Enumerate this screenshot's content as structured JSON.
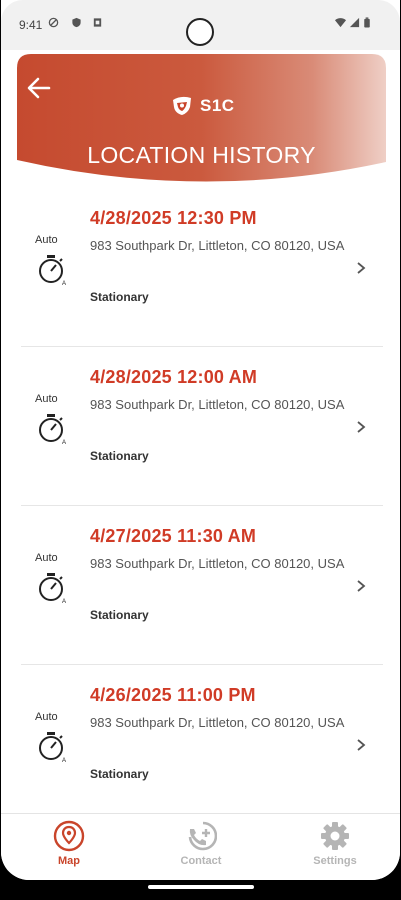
{
  "status_bar": {
    "time": "9:41"
  },
  "header": {
    "logo_text": "S1C",
    "title": "LOCATION HISTORY"
  },
  "items": [
    {
      "mode": "Auto",
      "datetime": "4/28/2025 12:30 PM",
      "address": "983 Southpark Dr, Littleton, CO 80120, USA",
      "status": "Stationary"
    },
    {
      "mode": "Auto",
      "datetime": "4/28/2025 12:00 AM",
      "address": "983 Southpark Dr, Littleton, CO 80120, USA",
      "status": "Stationary"
    },
    {
      "mode": "Auto",
      "datetime": "4/27/2025 11:30 AM",
      "address": "983 Southpark Dr, Littleton, CO 80120, USA",
      "status": "Stationary"
    },
    {
      "mode": "Auto",
      "datetime": "4/26/2025 11:00 PM",
      "address": "983 Southpark Dr, Littleton, CO 80120, USA",
      "status": "Stationary"
    }
  ],
  "tabs": [
    {
      "label": "Map",
      "icon": "map-pin-icon",
      "active": true
    },
    {
      "label": "Contact",
      "icon": "add-call-icon",
      "active": false
    },
    {
      "label": "Settings",
      "icon": "gear-icon",
      "active": false
    }
  ],
  "colors": {
    "accent": "#c9452b",
    "date_red": "#d03b26",
    "inactive": "#b5b5b5"
  }
}
